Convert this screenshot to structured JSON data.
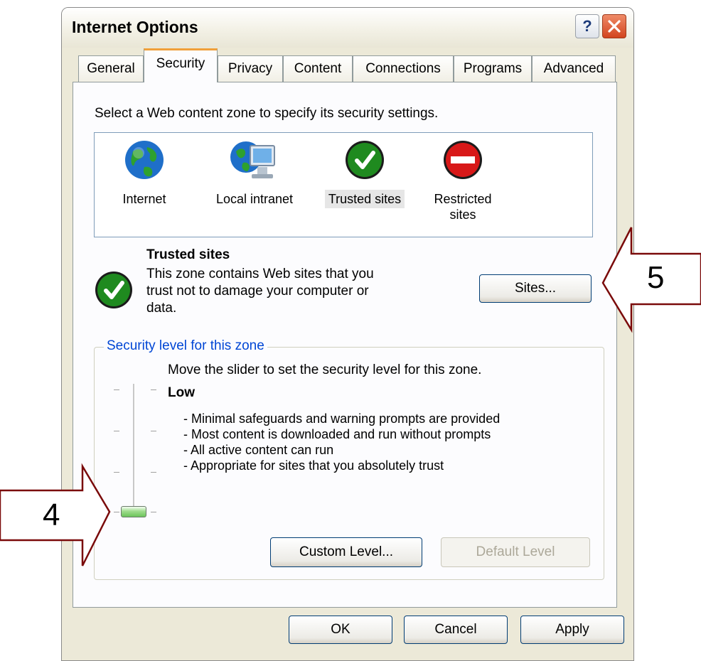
{
  "window": {
    "title": "Internet Options"
  },
  "tabs": [
    {
      "label": "General"
    },
    {
      "label": "Security"
    },
    {
      "label": "Privacy"
    },
    {
      "label": "Content"
    },
    {
      "label": "Connections"
    },
    {
      "label": "Programs"
    },
    {
      "label": "Advanced"
    }
  ],
  "security": {
    "intro": "Select a Web content zone to specify its security settings.",
    "zones": [
      {
        "label": "Internet",
        "icon": "globe-icon"
      },
      {
        "label": "Local intranet",
        "icon": "intranet-icon"
      },
      {
        "label": "Trusted sites",
        "icon": "checkmark-icon",
        "selected": true
      },
      {
        "label": "Restricted sites",
        "label_line1": "Restricted",
        "label_line2": "sites",
        "icon": "no-entry-icon"
      }
    ],
    "selected_zone": {
      "title": "Trusted sites",
      "description_lines": [
        "This zone contains Web sites that you",
        "trust not to damage your computer or",
        "data."
      ]
    },
    "sites_button": "Sites...",
    "level_group": {
      "legend": "Security level for this zone",
      "hint": "Move the slider to set the security level for this zone.",
      "level_name": "Low",
      "bullets": [
        "- Minimal safeguards and warning prompts are provided",
        "- Most content is downloaded and run without prompts",
        "- All active content can run",
        "- Appropriate for sites that you absolutely trust"
      ],
      "slider_level_index": 0,
      "slider_levels": 4,
      "custom_level_button": "Custom Level...",
      "default_level_button": "Default Level"
    }
  },
  "footer": {
    "ok": "OK",
    "cancel": "Cancel",
    "apply": "Apply"
  },
  "annotations": [
    {
      "label": "5"
    },
    {
      "label": "4"
    }
  ],
  "colors": {
    "annotation": "#7a0a0a",
    "check_green": "#1f8a1f",
    "restricted_red": "#d81818",
    "xp_tab_accent": "#f0a03b"
  }
}
